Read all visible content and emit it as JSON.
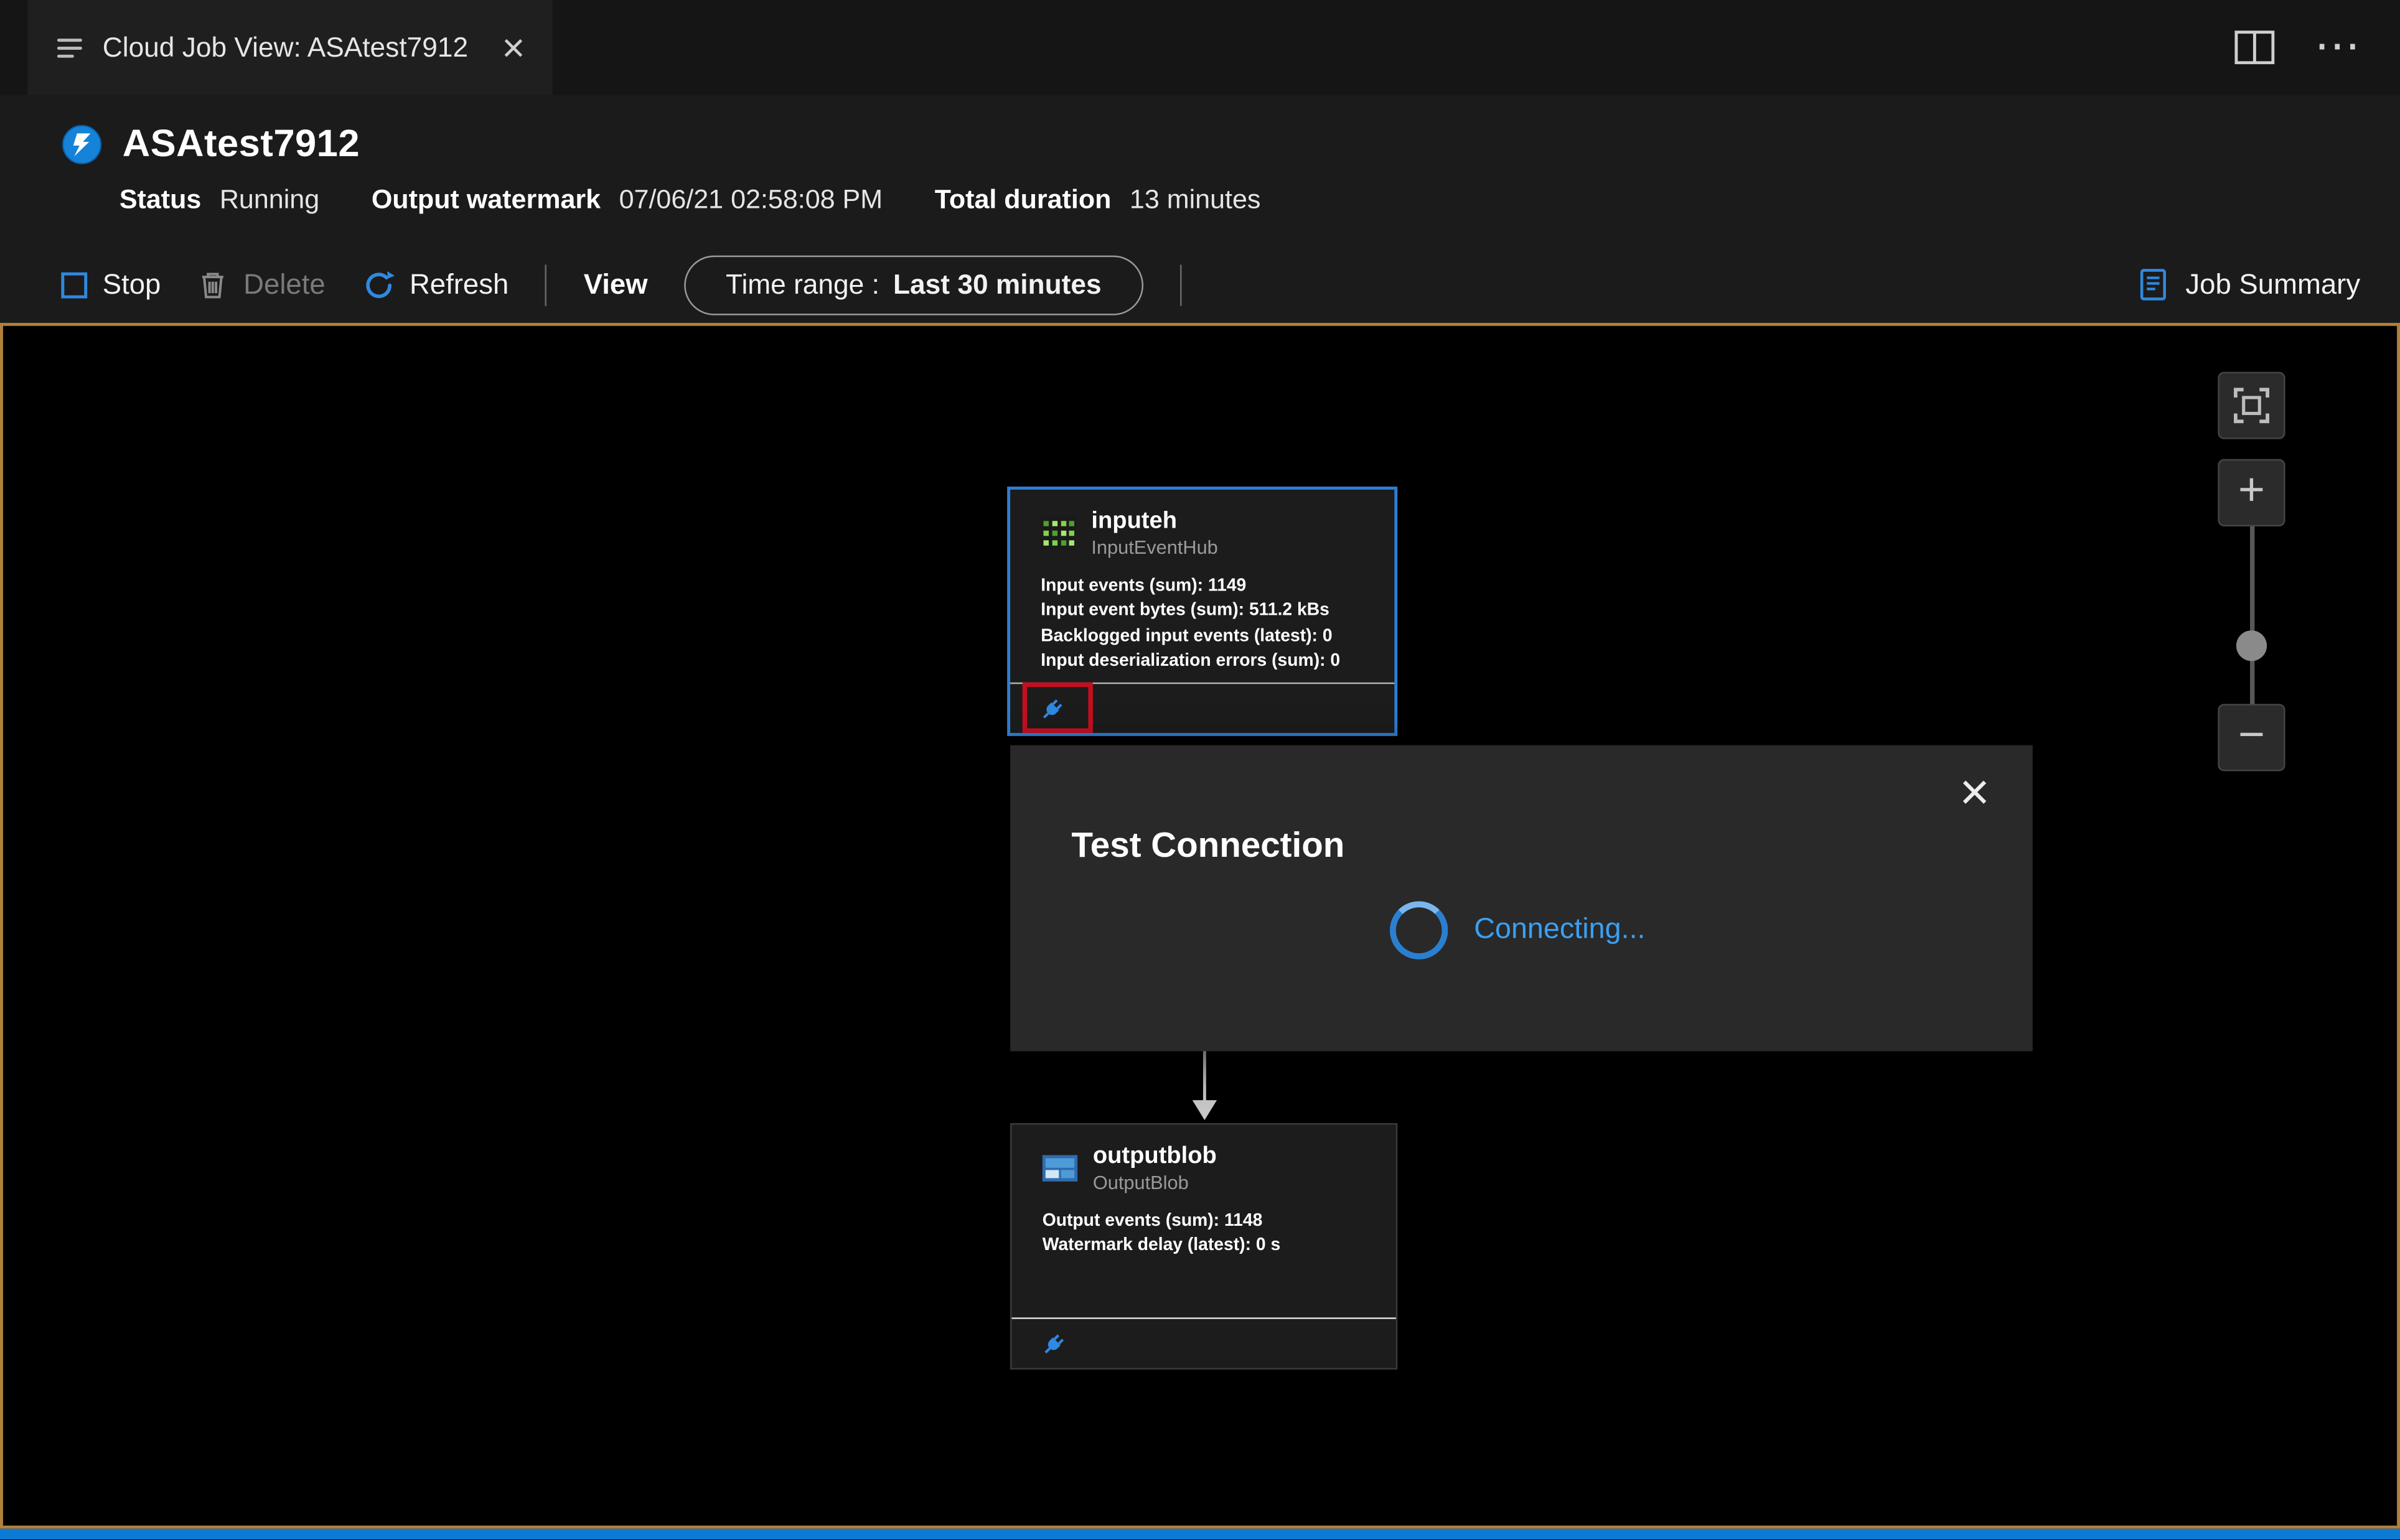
{
  "colors": {
    "accent_blue": "#2f89e0",
    "status_bar_blue": "#0b7bd6",
    "canvas_border_orange": "#b0813a",
    "node_highlight_blue": "#2e7dd2",
    "test_highlight_red": "#c50f1f",
    "connecting_text_blue": "#3aa0f3",
    "event_hub_green": "#7fd348"
  },
  "icons": {
    "tab_close": "×",
    "more_actions": "⋯",
    "zoom_in": "+",
    "zoom_out": "−",
    "dialog_close": "×"
  },
  "tab_bar": {
    "tab_title": "Cloud Job View: ASAtest7912"
  },
  "header": {
    "title": "ASAtest7912",
    "status_label": "Status",
    "status_value": "Running",
    "watermark_label": "Output watermark",
    "watermark_value": "07/06/21 02:58:08 PM",
    "duration_label": "Total duration",
    "duration_value": "13 minutes"
  },
  "toolbar": {
    "stop": "Stop",
    "delete": "Delete",
    "refresh": "Refresh",
    "view": "View",
    "time_range_label": "Time range :",
    "time_range_value": "Last 30 minutes",
    "job_summary": "Job Summary"
  },
  "diagram": {
    "input_node": {
      "title": "inputeh",
      "subtitle": "InputEventHub",
      "stats": [
        "Input events (sum): 1149",
        "Input event bytes (sum): 511.2 kBs",
        "Backlogged input events (latest): 0",
        "Input deserialization errors (sum): 0"
      ]
    },
    "output_node": {
      "title": "outputblob",
      "subtitle": "OutputBlob",
      "stats": [
        "Output events (sum): 1148",
        "Watermark delay (latest): 0 s"
      ]
    },
    "dialog": {
      "title": "Test Connection",
      "status": "Connecting..."
    }
  }
}
